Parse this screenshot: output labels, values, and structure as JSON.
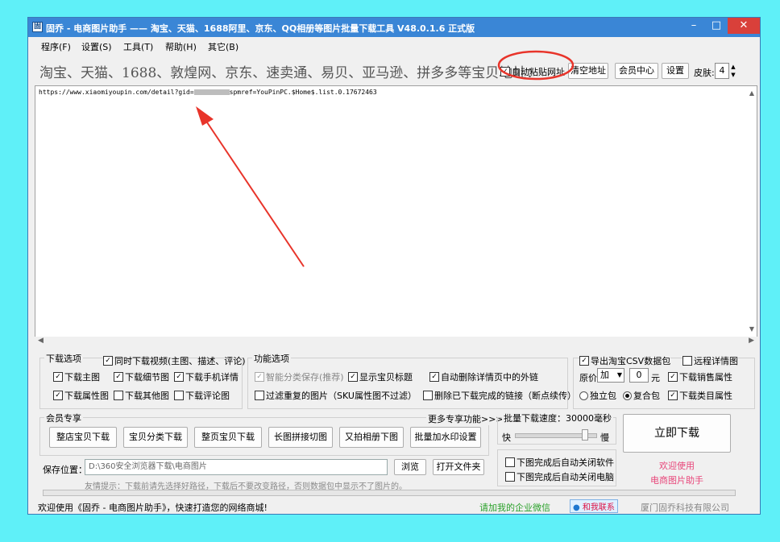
{
  "window": {
    "title": "固乔 - 电商图片助手 —— 淘宝、天猫、1688阿里、京东、QQ相册等图片批量下载工具 V48.0.1.6 正式版",
    "app_icon": "app-icon",
    "controls": {
      "minimize": "–",
      "maximize": "□",
      "close": "✕"
    }
  },
  "menu": [
    "程序(F)",
    "设置(S)",
    "工具(T)",
    "帮助(H)",
    "其它(B)"
  ],
  "toolbar": {
    "banner": "淘宝、天猫、1688、敦煌网、京东、速卖通、易贝、亚马逊、拼多多等宝贝地址：",
    "auto_paste_label": "自动粘贴网址",
    "auto_paste_checked": true,
    "clear_button": "清空地址",
    "member_button": "会员中心",
    "settings_button": "设置",
    "skin_label": "皮肤:",
    "skin_value": "4"
  },
  "url_box": {
    "text_prefix": "https://www.xiaomiyoupin.com/detail?gid=",
    "text_suffix": "spmref=YouPinPC.$Home$.list.0.17672463"
  },
  "download_options": {
    "title": "下载选项",
    "items": [
      {
        "label": "同时下载视频(主图、描述、评论)",
        "checked": true
      },
      {
        "label": "下载主图",
        "checked": true
      },
      {
        "label": "下载细节图",
        "checked": true
      },
      {
        "label": "下载手机详情",
        "checked": true
      },
      {
        "label": "下载属性图",
        "checked": true
      },
      {
        "label": "下载其他图",
        "checked": false
      },
      {
        "label": "下载评论图",
        "checked": false
      }
    ]
  },
  "feature_options": {
    "title": "功能选项",
    "items": [
      {
        "label": "智能分类保存(推荐)",
        "checked": true,
        "disabled": true
      },
      {
        "label": "显示宝贝标题",
        "checked": true
      },
      {
        "label": "自动删除详情页中的外链",
        "checked": true
      },
      {
        "label": "过滤重复的图片（SKU属性图不过滤）",
        "checked": false
      },
      {
        "label": "删除已下载完成的链接（断点续传）",
        "checked": false
      }
    ]
  },
  "export_options": {
    "export_csv": {
      "label": "导出淘宝CSV数据包",
      "checked": true
    },
    "remote_detail": {
      "label": "远程详情图",
      "checked": false
    },
    "price_label": "原价",
    "price_op": "加",
    "price_value": "0",
    "price_unit": "元",
    "sales_attr": {
      "label": "下载销售属性",
      "checked": true
    },
    "package_independent": "独立包",
    "package_combined": "复合包",
    "combined_selected": true,
    "category_attr": {
      "label": "下载类目属性",
      "checked": true
    }
  },
  "member_section": {
    "title": "会员专享",
    "more_link": "更多专享功能>>>",
    "buttons": [
      "整店宝贝下载",
      "宝贝分类下载",
      "整页宝贝下载",
      "长图拼接切图",
      "又拍相册下图",
      "批量加水印设置"
    ]
  },
  "speed": {
    "title": "批量下载速度：30000毫秒",
    "fast": "快",
    "slow": "慢",
    "level": 0.88
  },
  "download_button": "立即下载",
  "save": {
    "label": "保存位置：",
    "path": "D:\\360安全浏览器下载\\电商图片",
    "browse": "浏览",
    "open_folder": "打开文件夹",
    "hint": "友情提示：下载前请先选择好路径，下载后不要改变路径，否则数据包中显示不了图片的。"
  },
  "after_download": [
    {
      "label": "下图完成后自动关闭软件",
      "checked": false
    },
    {
      "label": "下图完成后自动关闭电脑",
      "checked": false
    }
  ],
  "welcome": {
    "line1": "欢迎使用",
    "line2": "电商图片助手"
  },
  "status": {
    "left": "欢迎使用《固乔 - 电商图片助手》，快速打造您的网络商城!",
    "wechat": "请加我的企业微信",
    "contact": "和我联系",
    "company": "厦门固乔科技有限公司"
  },
  "colors": {
    "annotation": "#e8342a",
    "titlebar": "#3a86d6",
    "wechat": "#2aa12a",
    "welcome": "#e8467a"
  }
}
